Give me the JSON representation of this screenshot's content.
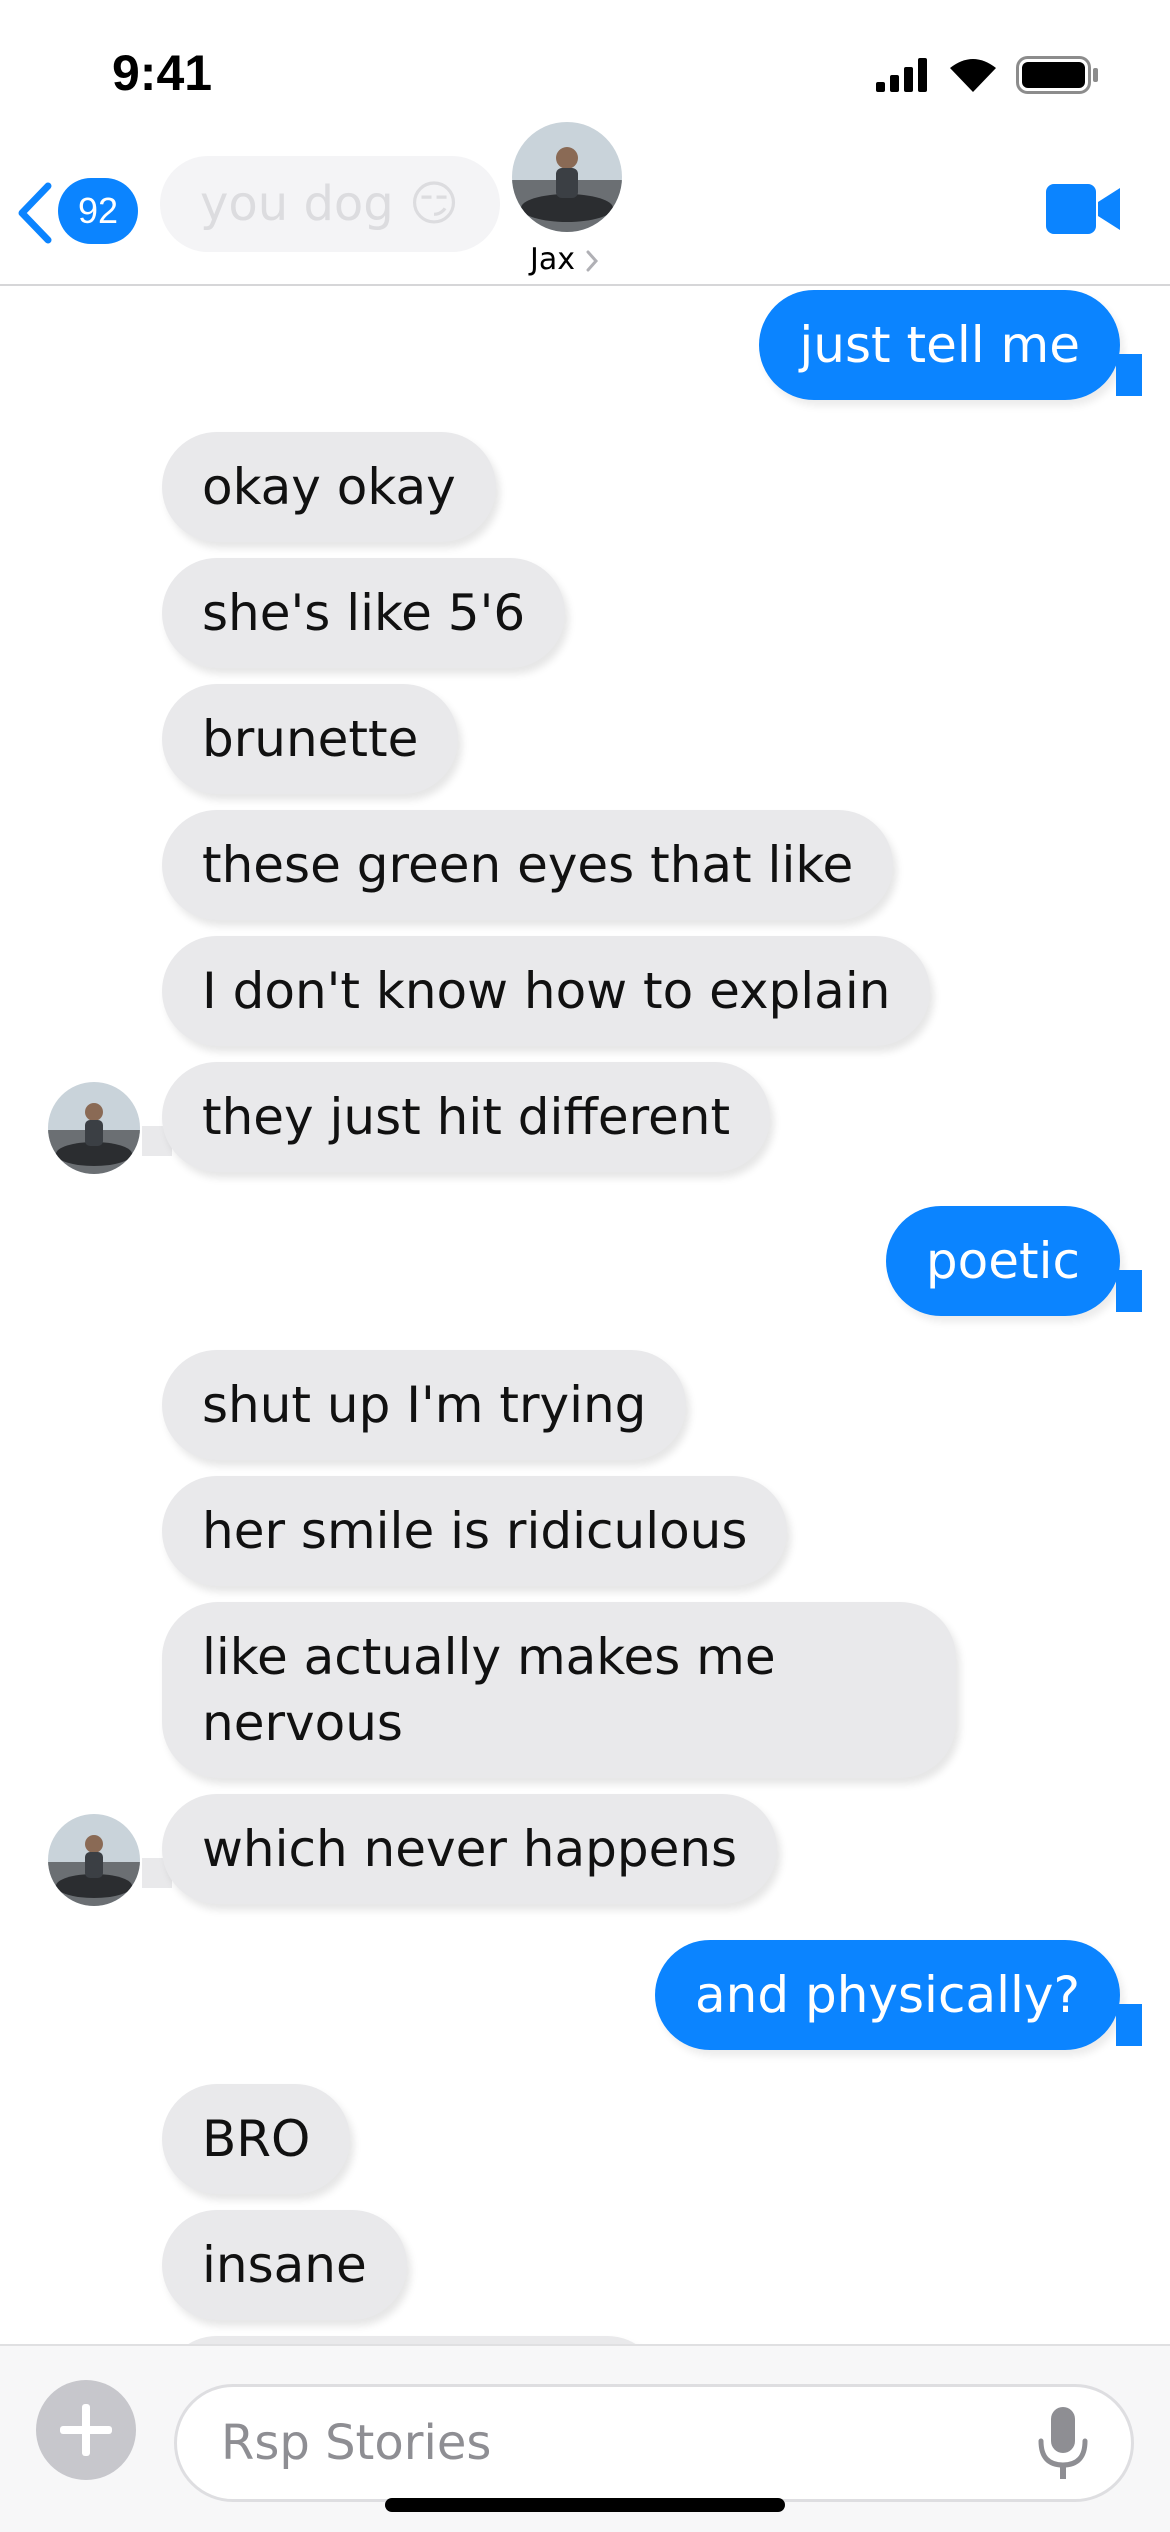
{
  "status_bar": {
    "time": "9:41",
    "icons": [
      "signal-icon",
      "wifi-icon",
      "battery-icon"
    ]
  },
  "nav": {
    "back_count": "92",
    "preview_text": "you dog 😏",
    "contact_name": "Jax",
    "icons": [
      "back-chevron-icon",
      "video-camera-icon",
      "chevron-right-icon"
    ]
  },
  "thread": {
    "messages": [
      {
        "from": "me",
        "text": "just tell me"
      },
      {
        "from": "them",
        "text": "okay okay"
      },
      {
        "from": "them",
        "text": "she's like 5'6"
      },
      {
        "from": "them",
        "text": "brunette"
      },
      {
        "from": "them",
        "text": "these green eyes that like"
      },
      {
        "from": "them",
        "text": "I don't know how to explain"
      },
      {
        "from": "them",
        "text": "they just hit different"
      },
      {
        "from": "me",
        "text": "poetic"
      },
      {
        "from": "them",
        "text": "shut up I'm trying"
      },
      {
        "from": "them",
        "text": "her smile is ridiculous"
      },
      {
        "from": "them",
        "text": "like actually makes me nervous"
      },
      {
        "from": "them",
        "text": "which never happens"
      },
      {
        "from": "me",
        "text": "and physically?"
      },
      {
        "from": "them",
        "text": "BRO"
      },
      {
        "from": "them",
        "text": "insane"
      }
    ]
  },
  "composer": {
    "placeholder": "Rsp Stories",
    "icons": [
      "plus-icon",
      "microphone-icon"
    ]
  },
  "colors": {
    "accent_blue": "#0b84ff",
    "incoming_bubble": "#e9e9eb",
    "background": "#ffffff"
  }
}
